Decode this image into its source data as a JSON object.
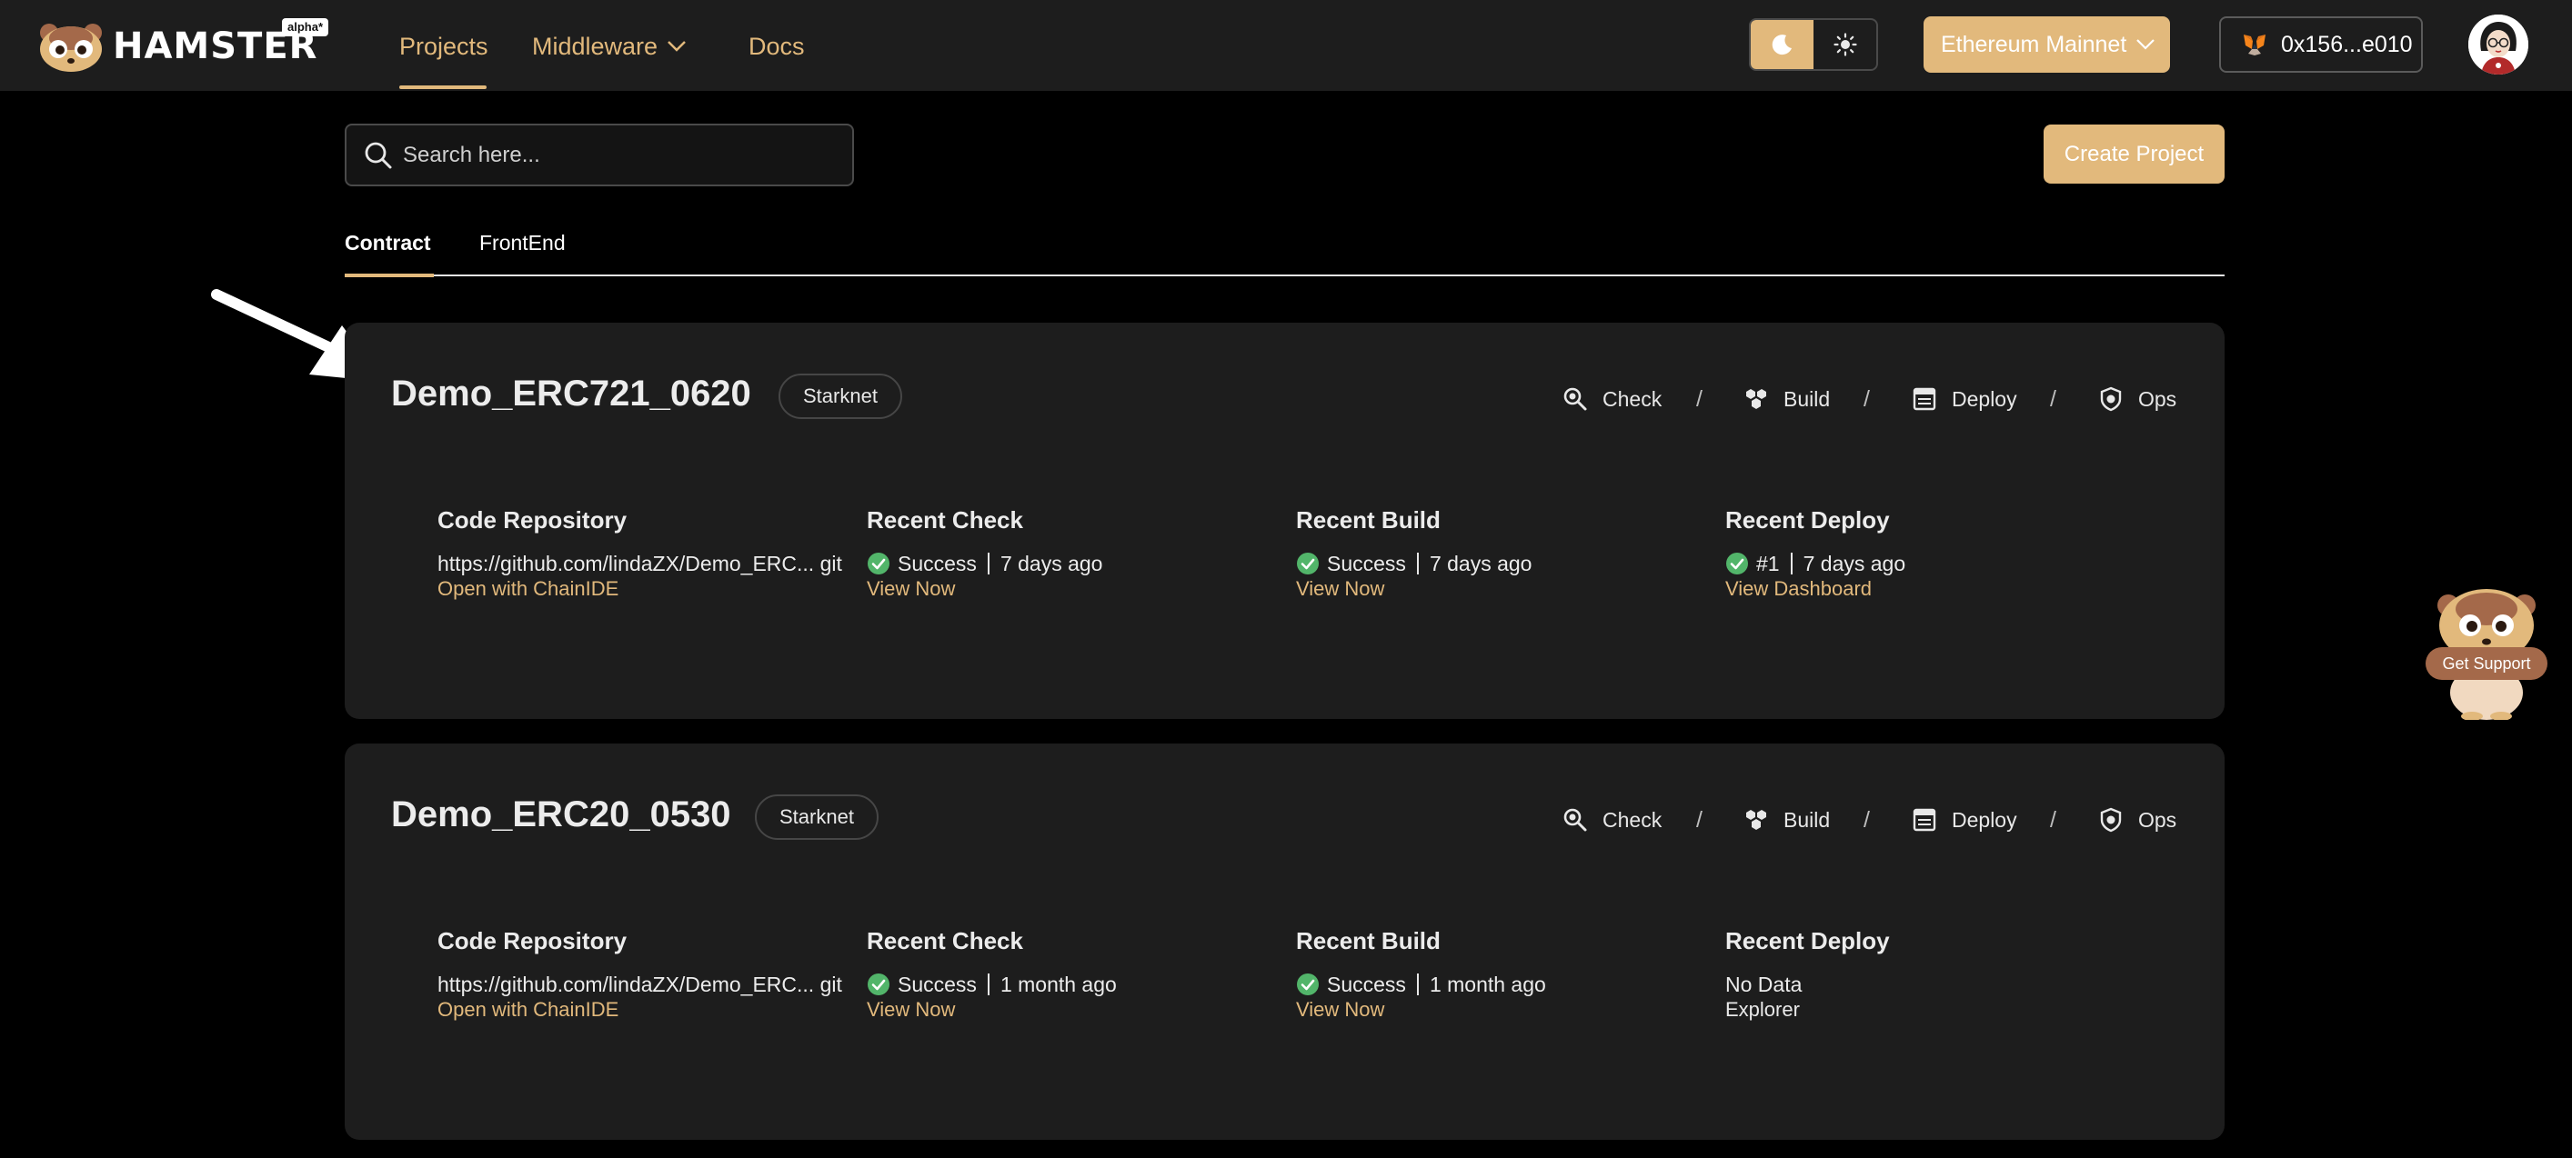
{
  "brand": {
    "name": "HAMSTER",
    "badge": "alpha*"
  },
  "nav": {
    "projects": "Projects",
    "middleware": "Middleware",
    "docs": "Docs"
  },
  "header": {
    "theme_dark_icon": "moon-icon",
    "theme_light_icon": "sun-icon",
    "network": "Ethereum Mainnet",
    "wallet": "0x156...e010",
    "accent_color": "#e2b97c"
  },
  "search": {
    "placeholder": "Search here..."
  },
  "actions": {
    "create_project": "Create Project"
  },
  "tabs": {
    "contract": "Contract",
    "frontend": "FrontEnd",
    "active": "Contract"
  },
  "pipeline": {
    "check": "Check",
    "build": "Build",
    "deploy": "Deploy",
    "ops": "Ops",
    "separator": "/"
  },
  "projects": [
    {
      "name": "Demo_ERC721_0620",
      "chain": "Starknet",
      "repo_title": "Code Repository",
      "repo_url": "https://github.com/lindaZX/Demo_ERC... git",
      "repo_link": "Open with ChainIDE",
      "check_title": "Recent Check",
      "check_status": "Success",
      "check_time": "7 days ago",
      "check_link": "View Now",
      "build_title": "Recent Build",
      "build_status": "Success",
      "build_time": "7 days ago",
      "build_link": "View Now",
      "deploy_title": "Recent Deploy",
      "deploy_status": "#1",
      "deploy_time": "7 days ago",
      "deploy_link": "View Dashboard"
    },
    {
      "name": "Demo_ERC20_0530",
      "chain": "Starknet",
      "repo_title": "Code Repository",
      "repo_url": "https://github.com/lindaZX/Demo_ERC... git",
      "repo_link": "Open with ChainIDE",
      "check_title": "Recent Check",
      "check_status": "Success",
      "check_time": "1 month ago",
      "check_link": "View Now",
      "build_title": "Recent Build",
      "build_status": "Success",
      "build_time": "1 month ago",
      "build_link": "View Now",
      "deploy_title": "Recent Deploy",
      "deploy_status": "No Data",
      "deploy_link": "Explorer"
    }
  ],
  "support": {
    "label": "Get Support"
  }
}
